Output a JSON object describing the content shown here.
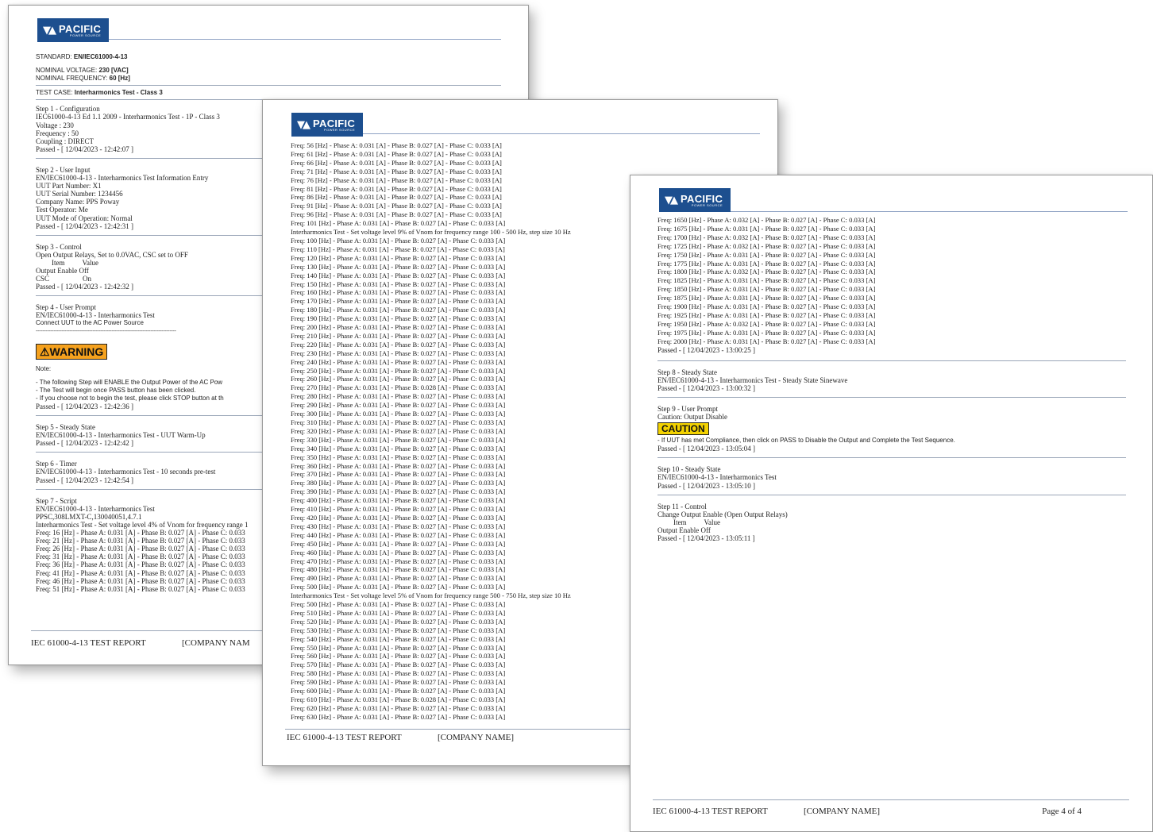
{
  "brand": {
    "name": "PACIFIC",
    "tagline": "POWER SOURCE"
  },
  "page1": {
    "standard_label": "STANDARD:",
    "standard_value": "EN/IEC61000-4-13",
    "voltage_label": "NOMINAL VOLTAGE:",
    "voltage_value": "230 [VAC]",
    "frequency_label": "NOMINAL FREQUENCY:",
    "frequency_value": "60 [Hz]",
    "testcase_label": "TEST CASE:",
    "testcase_value": "Interharmonics Test - Class 3",
    "step1": [
      "Step 1 - Configuration",
      "IEC61000-4-13 Ed 1.1 2009 - Interharmonics Test - 1P - Class 3",
      "Voltage : 230",
      "Frequency : 50",
      "Coupling : DIRECT",
      "Passed - [ 12/04/2023 - 12:42:07 ]"
    ],
    "step2": [
      "Step 2 - User Input",
      "EN/IEC61000-4-13 - Interharmonics Test Information Entry",
      "UUT Part Number: X1",
      "UUT Serial Number: 1234456",
      "Company Name: PPS Poway",
      "Test Operator: Me",
      "UUT Mode of Operation: Normal",
      "Passed - [ 12/04/2023 - 12:42:31 ]"
    ],
    "step3": [
      "Step 3 - Control",
      "Open Output Relays, Set to 0.0VAC, CSC set to OFF"
    ],
    "step3_table_head": [
      "Item",
      "Value"
    ],
    "step3_rows": [
      [
        "Output Enable",
        "Off"
      ],
      [
        "CSC",
        "On"
      ]
    ],
    "step3_passed": "Passed - [ 12/04/2023 - 12:42:32 ]",
    "step4": [
      "Step 4 - User Prompt",
      "EN/IEC61000-4-13 - Interharmonics Test"
    ],
    "step4_prompt": "Connect UUT to the AC Power Source",
    "step4_dashes": "---------------------------------------------------------------------------------------",
    "warning": "⚠WARNING",
    "note": "Note:",
    "note_lines": [
      "- The following Step will ENABLE the Output Power of the AC Pow",
      "- The Test will begin once PASS button has been clicked.",
      "- If you choose not to begin the test, please click STOP button at th"
    ],
    "step4_passed": "Passed - [ 12/04/2023 - 12:42:36 ]",
    "step5": [
      "Step 5 - Steady State",
      "EN/IEC61000-4-13 - Interharmonics Test - UUT Warm-Up",
      "Passed - [ 12/04/2023 - 12:42:42 ]"
    ],
    "step6": [
      "Step 6 - Timer",
      "EN/IEC61000-4-13 - Interharmonics Test - 10 seconds pre-test",
      "Passed - [ 12/04/2023 - 12:42:54 ]"
    ],
    "step7": [
      "Step 7 - Script",
      "EN/IEC61000-4-13 - Interharmonics Test",
      "PPSC,308LMXT-C,130040051,4.7.1",
      "Interharmonics Test - Set voltage level 4% of Vnom for frequency range 1"
    ],
    "step7_freqs": [
      "Freq: 16 [Hz] - Phase A: 0.031 [A] - Phase B: 0.027 [A] - Phase C: 0.033",
      "Freq: 21 [Hz] - Phase A: 0.031 [A] - Phase B: 0.027 [A] - Phase C: 0.033",
      "Freq: 26 [Hz] - Phase A: 0.031 [A] - Phase B: 0.027 [A] - Phase C: 0.033",
      "Freq: 31 [Hz] - Phase A: 0.031 [A] - Phase B: 0.027 [A] - Phase C: 0.033",
      "Freq: 36 [Hz] - Phase A: 0.031 [A] - Phase B: 0.027 [A] - Phase C: 0.033",
      "Freq: 41 [Hz] - Phase A: 0.031 [A] - Phase B: 0.027 [A] - Phase C: 0.033",
      "Freq: 46 [Hz] - Phase A: 0.031 [A] - Phase B: 0.027 [A] - Phase C: 0.033",
      "Freq: 51 [Hz] - Phase A: 0.031 [A] - Phase B: 0.027 [A] - Phase C: 0.033"
    ],
    "footer_title": "IEC 61000-4-13 TEST REPORT",
    "footer_company": "[COMPANY NAM"
  },
  "page2": {
    "lines": [
      "Freq: 56 [Hz] - Phase A: 0.031 [A] - Phase B: 0.027 [A] - Phase C: 0.033 [A]",
      "Freq: 61 [Hz] - Phase A: 0.031 [A] - Phase B: 0.027 [A] - Phase C: 0.033 [A]",
      "Freq: 66 [Hz] - Phase A: 0.031 [A] - Phase B: 0.027 [A] - Phase C: 0.033 [A]",
      "Freq: 71 [Hz] - Phase A: 0.031 [A] - Phase B: 0.027 [A] - Phase C: 0.033 [A]",
      "Freq: 76 [Hz] - Phase A: 0.031 [A] - Phase B: 0.027 [A] - Phase C: 0.033 [A]",
      "Freq: 81 [Hz] - Phase A: 0.031 [A] - Phase B: 0.027 [A] - Phase C: 0.033 [A]",
      "Freq: 86 [Hz] - Phase A: 0.031 [A] - Phase B: 0.027 [A] - Phase C: 0.033 [A]",
      "Freq: 91 [Hz] - Phase A: 0.031 [A] - Phase B: 0.027 [A] - Phase C: 0.033 [A]",
      "Freq: 96 [Hz] - Phase A: 0.031 [A] - Phase B: 0.027 [A] - Phase C: 0.033 [A]",
      "Freq: 101 [Hz] - Phase A: 0.031 [A] - Phase B: 0.027 [A] - Phase C: 0.033 [A]",
      "Interharmonics Test - Set voltage level 9% of Vnom for frequency range 100 - 500 Hz, step size 10 Hz",
      "Freq: 100 [Hz] - Phase A: 0.031 [A] - Phase B: 0.027 [A] - Phase C: 0.033 [A]",
      "Freq: 110 [Hz] - Phase A: 0.031 [A] - Phase B: 0.027 [A] - Phase C: 0.033 [A]",
      "Freq: 120 [Hz] - Phase A: 0.031 [A] - Phase B: 0.027 [A] - Phase C: 0.033 [A]",
      "Freq: 130 [Hz] - Phase A: 0.031 [A] - Phase B: 0.027 [A] - Phase C: 0.033 [A]",
      "Freq: 140 [Hz] - Phase A: 0.031 [A] - Phase B: 0.027 [A] - Phase C: 0.033 [A]",
      "Freq: 150 [Hz] - Phase A: 0.031 [A] - Phase B: 0.027 [A] - Phase C: 0.033 [A]",
      "Freq: 160 [Hz] - Phase A: 0.031 [A] - Phase B: 0.027 [A] - Phase C: 0.033 [A]",
      "Freq: 170 [Hz] - Phase A: 0.031 [A] - Phase B: 0.027 [A] - Phase C: 0.033 [A]",
      "Freq: 180 [Hz] - Phase A: 0.031 [A] - Phase B: 0.027 [A] - Phase C: 0.033 [A]",
      "Freq: 190 [Hz] - Phase A: 0.031 [A] - Phase B: 0.027 [A] - Phase C: 0.033 [A]",
      "Freq: 200 [Hz] - Phase A: 0.031 [A] - Phase B: 0.027 [A] - Phase C: 0.033 [A]",
      "Freq: 210 [Hz] - Phase A: 0.031 [A] - Phase B: 0.027 [A] - Phase C: 0.033 [A]",
      "Freq: 220 [Hz] - Phase A: 0.031 [A] - Phase B: 0.027 [A] - Phase C: 0.033 [A]",
      "Freq: 230 [Hz] - Phase A: 0.031 [A] - Phase B: 0.027 [A] - Phase C: 0.033 [A]",
      "Freq: 240 [Hz] - Phase A: 0.031 [A] - Phase B: 0.027 [A] - Phase C: 0.033 [A]",
      "Freq: 250 [Hz] - Phase A: 0.031 [A] - Phase B: 0.027 [A] - Phase C: 0.033 [A]",
      "Freq: 260 [Hz] - Phase A: 0.031 [A] - Phase B: 0.027 [A] - Phase C: 0.033 [A]",
      "Freq: 270 [Hz] - Phase A: 0.031 [A] - Phase B: 0.028 [A] - Phase C: 0.033 [A]",
      "Freq: 280 [Hz] - Phase A: 0.031 [A] - Phase B: 0.027 [A] - Phase C: 0.033 [A]",
      "Freq: 290 [Hz] - Phase A: 0.031 [A] - Phase B: 0.027 [A] - Phase C: 0.033 [A]",
      "Freq: 300 [Hz] - Phase A: 0.031 [A] - Phase B: 0.027 [A] - Phase C: 0.033 [A]",
      "Freq: 310 [Hz] - Phase A: 0.031 [A] - Phase B: 0.027 [A] - Phase C: 0.033 [A]",
      "Freq: 320 [Hz] - Phase A: 0.031 [A] - Phase B: 0.027 [A] - Phase C: 0.033 [A]",
      "Freq: 330 [Hz] - Phase A: 0.031 [A] - Phase B: 0.027 [A] - Phase C: 0.033 [A]",
      "Freq: 340 [Hz] - Phase A: 0.031 [A] - Phase B: 0.027 [A] - Phase C: 0.033 [A]",
      "Freq: 350 [Hz] - Phase A: 0.031 [A] - Phase B: 0.027 [A] - Phase C: 0.033 [A]",
      "Freq: 360 [Hz] - Phase A: 0.031 [A] - Phase B: 0.027 [A] - Phase C: 0.033 [A]",
      "Freq: 370 [Hz] - Phase A: 0.031 [A] - Phase B: 0.027 [A] - Phase C: 0.033 [A]",
      "Freq: 380 [Hz] - Phase A: 0.031 [A] - Phase B: 0.027 [A] - Phase C: 0.033 [A]",
      "Freq: 390 [Hz] - Phase A: 0.031 [A] - Phase B: 0.027 [A] - Phase C: 0.033 [A]",
      "Freq: 400 [Hz] - Phase A: 0.031 [A] - Phase B: 0.027 [A] - Phase C: 0.033 [A]",
      "Freq: 410 [Hz] - Phase A: 0.031 [A] - Phase B: 0.027 [A] - Phase C: 0.033 [A]",
      "Freq: 420 [Hz] - Phase A: 0.031 [A] - Phase B: 0.027 [A] - Phase C: 0.033 [A]",
      "Freq: 430 [Hz] - Phase A: 0.031 [A] - Phase B: 0.027 [A] - Phase C: 0.033 [A]",
      "Freq: 440 [Hz] - Phase A: 0.031 [A] - Phase B: 0.027 [A] - Phase C: 0.033 [A]",
      "Freq: 450 [Hz] - Phase A: 0.031 [A] - Phase B: 0.027 [A] - Phase C: 0.033 [A]",
      "Freq: 460 [Hz] - Phase A: 0.031 [A] - Phase B: 0.027 [A] - Phase C: 0.033 [A]",
      "Freq: 470 [Hz] - Phase A: 0.031 [A] - Phase B: 0.027 [A] - Phase C: 0.033 [A]",
      "Freq: 480 [Hz] - Phase A: 0.031 [A] - Phase B: 0.027 [A] - Phase C: 0.033 [A]",
      "Freq: 490 [Hz] - Phase A: 0.031 [A] - Phase B: 0.027 [A] - Phase C: 0.033 [A]",
      "Freq: 500 [Hz] - Phase A: 0.031 [A] - Phase B: 0.027 [A] - Phase C: 0.033 [A]",
      "Interharmonics Test - Set voltage level 5% of Vnom for frequency range 500 - 750 Hz, step size 10 Hz",
      "Freq: 500 [Hz] - Phase A: 0.031 [A] - Phase B: 0.027 [A] - Phase C: 0.033 [A]",
      "Freq: 510 [Hz] - Phase A: 0.031 [A] - Phase B: 0.027 [A] - Phase C: 0.033 [A]",
      "Freq: 520 [Hz] - Phase A: 0.031 [A] - Phase B: 0.027 [A] - Phase C: 0.033 [A]",
      "Freq: 530 [Hz] - Phase A: 0.031 [A] - Phase B: 0.027 [A] - Phase C: 0.033 [A]",
      "Freq: 540 [Hz] - Phase A: 0.031 [A] - Phase B: 0.027 [A] - Phase C: 0.033 [A]",
      "Freq: 550 [Hz] - Phase A: 0.031 [A] - Phase B: 0.027 [A] - Phase C: 0.033 [A]",
      "Freq: 560 [Hz] - Phase A: 0.031 [A] - Phase B: 0.027 [A] - Phase C: 0.033 [A]",
      "Freq: 570 [Hz] - Phase A: 0.031 [A] - Phase B: 0.027 [A] - Phase C: 0.033 [A]",
      "Freq: 580 [Hz] - Phase A: 0.031 [A] - Phase B: 0.027 [A] - Phase C: 0.033 [A]",
      "Freq: 590 [Hz] - Phase A: 0.031 [A] - Phase B: 0.027 [A] - Phase C: 0.033 [A]",
      "Freq: 600 [Hz] - Phase A: 0.031 [A] - Phase B: 0.027 [A] - Phase C: 0.033 [A]",
      "Freq: 610 [Hz] - Phase A: 0.031 [A] - Phase B: 0.028 [A] - Phase C: 0.033 [A]",
      "Freq: 620 [Hz] - Phase A: 0.031 [A] - Phase B: 0.027 [A] - Phase C: 0.033 [A]",
      "Freq: 630 [Hz] - Phase A: 0.031 [A] - Phase B: 0.027 [A] - Phase C: 0.033 [A]"
    ],
    "footer_title": "IEC 61000-4-13 TEST REPORT",
    "footer_company": "[COMPANY NAME]"
  },
  "page3": {
    "freq_lines": [
      "Freq: 1650 [Hz] - Phase A: 0.032 [A] - Phase B: 0.027 [A] - Phase C: 0.033 [A]",
      "Freq: 1675 [Hz] - Phase A: 0.031 [A] - Phase B: 0.027 [A] - Phase C: 0.033 [A]",
      "Freq: 1700 [Hz] - Phase A: 0.032 [A] - Phase B: 0.027 [A] - Phase C: 0.033 [A]",
      "Freq: 1725 [Hz] - Phase A: 0.032 [A] - Phase B: 0.027 [A] - Phase C: 0.033 [A]",
      "Freq: 1750 [Hz] - Phase A: 0.031 [A] - Phase B: 0.027 [A] - Phase C: 0.033 [A]",
      "Freq: 1775 [Hz] - Phase A: 0.031 [A] - Phase B: 0.027 [A] - Phase C: 0.033 [A]",
      "Freq: 1800 [Hz] - Phase A: 0.032 [A] - Phase B: 0.027 [A] - Phase C: 0.033 [A]",
      "Freq: 1825 [Hz] - Phase A: 0.031 [A] - Phase B: 0.027 [A] - Phase C: 0.033 [A]",
      "Freq: 1850 [Hz] - Phase A: 0.031 [A] - Phase B: 0.027 [A] - Phase C: 0.033 [A]",
      "Freq: 1875 [Hz] - Phase A: 0.031 [A] - Phase B: 0.027 [A] - Phase C: 0.033 [A]",
      "Freq: 1900 [Hz] - Phase A: 0.031 [A] - Phase B: 0.027 [A] - Phase C: 0.033 [A]",
      "Freq: 1925 [Hz] - Phase A: 0.031 [A] - Phase B: 0.027 [A] - Phase C: 0.033 [A]",
      "Freq: 1950 [Hz] - Phase A: 0.032 [A] - Phase B: 0.027 [A] - Phase C: 0.033 [A]",
      "Freq: 1975 [Hz] - Phase A: 0.031 [A] - Phase B: 0.027 [A] - Phase C: 0.033 [A]",
      "Freq: 2000 [Hz] - Phase A: 0.031 [A] - Phase B: 0.027 [A] - Phase C: 0.033 [A]"
    ],
    "step7_passed": "Passed - [ 12/04/2023 - 13:00:25 ]",
    "step8": [
      "Step 8 - Steady State",
      "EN/IEC61000-4-13 - Interharmonics Test - Steady State Sinewave",
      "Passed - [ 12/04/2023 - 13:00:32 ]"
    ],
    "step9": [
      "Step 9 - User Prompt",
      "Caution: Output Disable"
    ],
    "caution": "CAUTION",
    "step9_note": "- If UUT has met Compliance, then click on PASS to Disable the Output and Complete the Test Sequence.",
    "step9_passed": "Passed - [ 12/04/2023 - 13:05:04 ]",
    "step10": [
      "Step 10 - Steady State",
      "EN/IEC61000-4-13 - Interharmonics Test",
      "Passed - [ 12/04/2023 - 13:05:10 ]"
    ],
    "step11": [
      "Step 11 - Control",
      "Change Output Enable (Open Output Relays)"
    ],
    "step11_table_head": [
      "Item",
      "Value"
    ],
    "step11_rows": [
      [
        "Output Enable",
        "Off"
      ]
    ],
    "step11_passed": "Passed - [ 12/04/2023 - 13:05:11 ]",
    "footer_title": "IEC 61000-4-13 TEST REPORT",
    "footer_company": "[COMPANY NAME]",
    "footer_page": "Page 4 of 4"
  },
  "colors": {
    "brand_blue": "#1d4f8f",
    "warning_orange": "#f5a11d",
    "caution_yellow": "#f3d200"
  }
}
